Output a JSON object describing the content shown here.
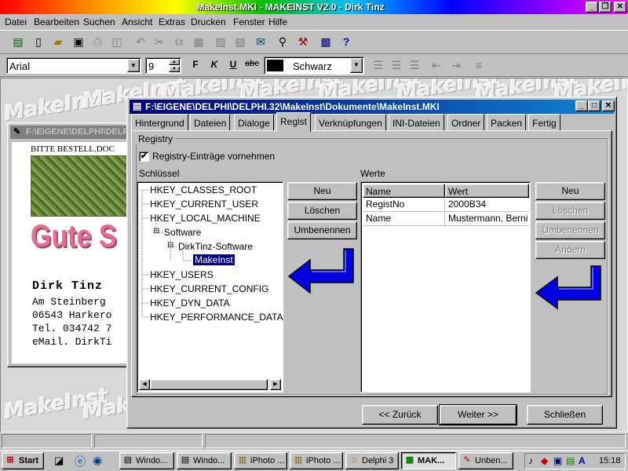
{
  "app": {
    "title": "MakeInst.MKI - MAKEINST V2.0 - Dirk Tinz"
  },
  "menu": [
    "Datei",
    "Bearbeiten",
    "Suchen",
    "Ansicht",
    "Extras",
    "Drucken",
    "Fenster",
    "Hilfe"
  ],
  "fontbar": {
    "font": "Arial",
    "size": "9",
    "bold": "F",
    "italic": "K",
    "underline": "U",
    "strike": "abc",
    "color_name": "Schwarz",
    "color": "#000000"
  },
  "watermark": "MakeInst",
  "bg_window": {
    "title": "F:\\EIGENE\\DELPHI\\DELPHI.3...",
    "header": "BITTE BESTELL.DOC",
    "logo": "Gute S",
    "lines": [
      "Dirk Tinz",
      "Am Steinberg",
      "06543 Harkero",
      "Tel. 034742 7",
      "eMail. DirkTi"
    ]
  },
  "dialog": {
    "title": "F:\\EIGENE\\DELPHI\\DELPHI.32\\MakeInst\\Dokumente\\MakeInst.MKI",
    "tabs": [
      "Hintergrund",
      "Dateien",
      "Dialoge",
      "Regist",
      "Verknüpfungen",
      "INI-Dateien",
      "Ordner",
      "Packen",
      "Fertig"
    ],
    "active_tab": "Regist",
    "group_label": "Registry",
    "checkbox_label": "Registry-Einträge vornehmen",
    "checkbox_checked": true,
    "keys_label": "Schlüssel",
    "values_label": "Werte",
    "tree": [
      "HKEY_CLASSES_ROOT",
      "HKEY_CURRENT_USER",
      "HKEY_LOCAL_MACHINE",
      "Software",
      "DirkTinz-Software",
      "MakeInst",
      "HKEY_USERS",
      "HKEY_CURRENT_CONFIG",
      "HKEY_DYN_DATA",
      "HKEY_PERFORMANCE_DATA"
    ],
    "selected_key": "MakeInst",
    "key_buttons": {
      "new": "Neu",
      "delete": "Löschen",
      "rename": "Umbenennen"
    },
    "value_columns": [
      "Name",
      "Wert"
    ],
    "value_rows": [
      [
        "RegistNo",
        "2000B34"
      ],
      [
        "Name",
        "Mustermann, Berni"
      ]
    ],
    "value_buttons": {
      "new": "Neu",
      "delete": "Löschen",
      "rename": "Umbenennen",
      "change": "Ändern"
    },
    "nav": {
      "back": "<< Zurück",
      "next": "Weiter >>",
      "close": "Schließen"
    },
    "arrow_color": "#0000e0"
  },
  "taskbar": {
    "start": "Start",
    "tasks": [
      "Windo...",
      "Windo...",
      "iPhoto ...",
      "iPhoto ...",
      "Delphi 3",
      "MAK...",
      "Unben..."
    ],
    "active_task": "MAK...",
    "clock": "15:18"
  }
}
